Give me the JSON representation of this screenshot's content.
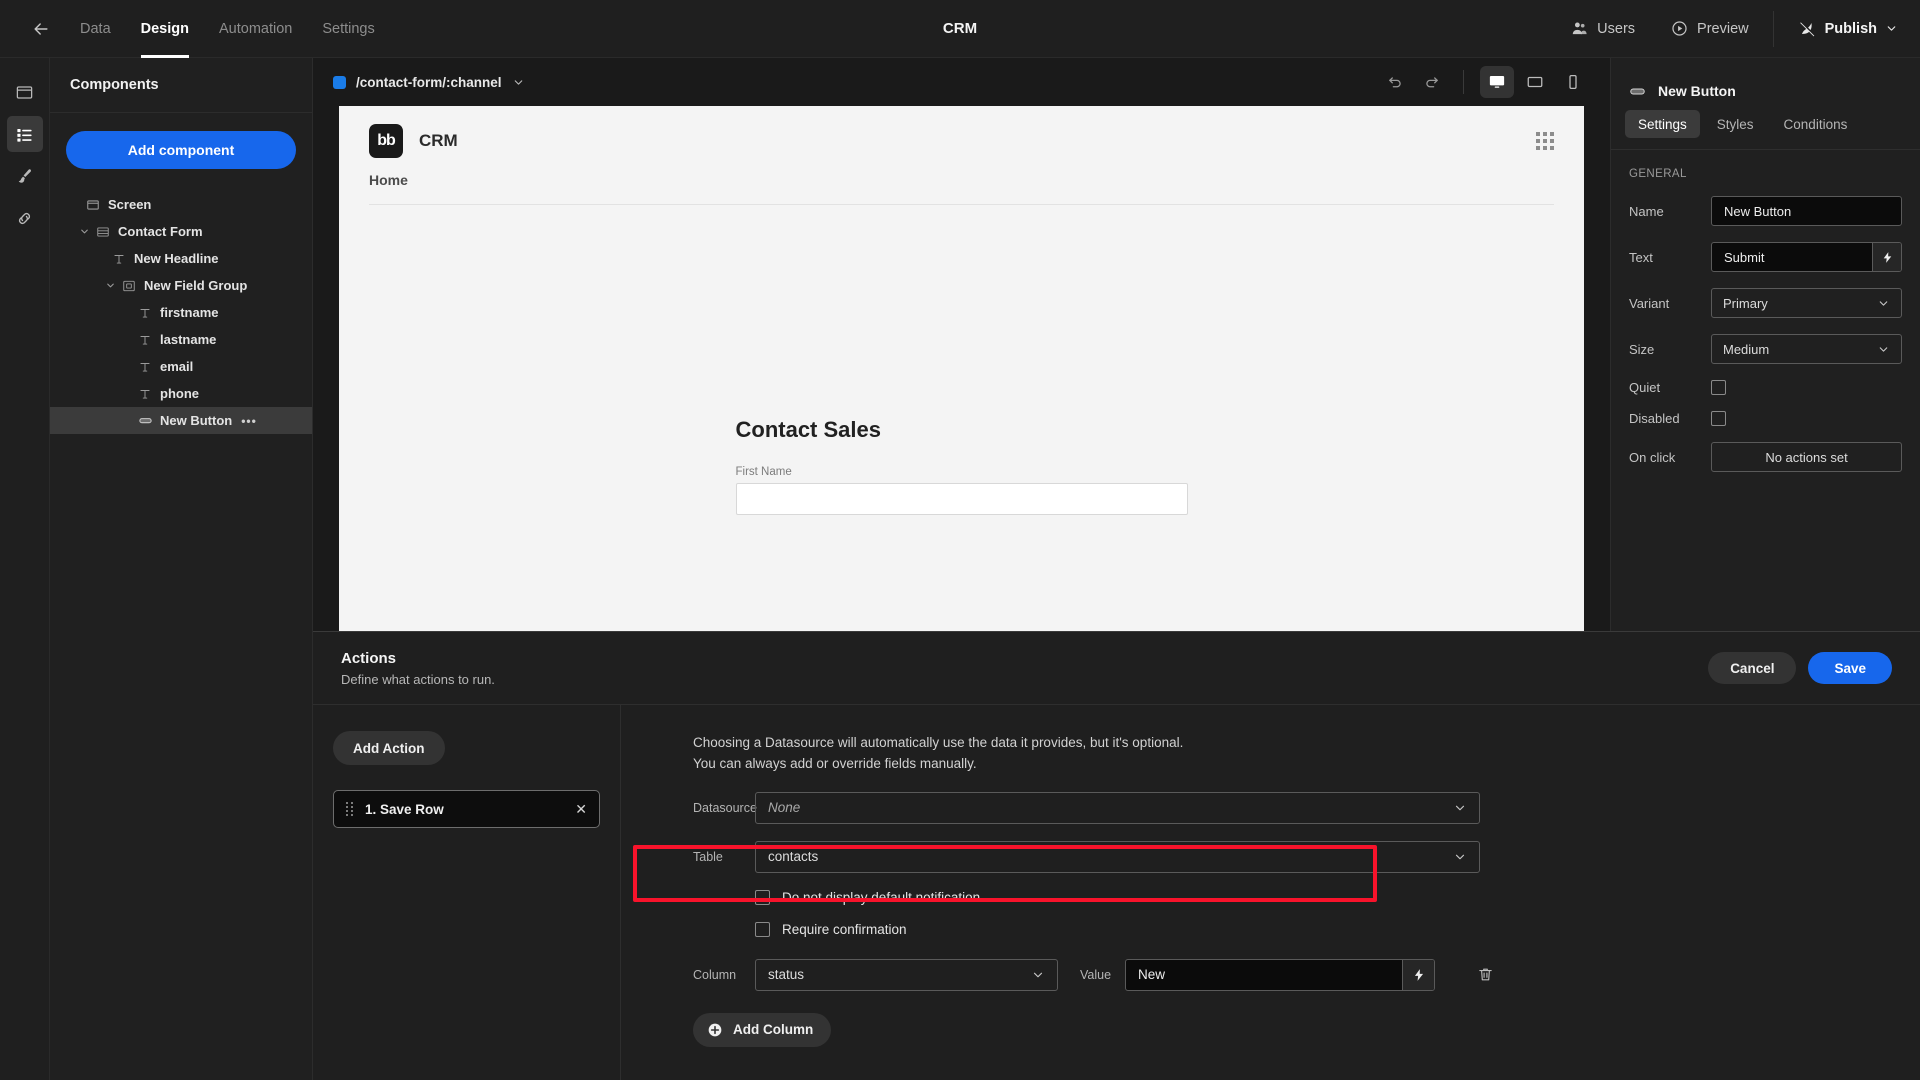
{
  "topbar": {
    "back_icon": "arrow-left-icon",
    "nav": [
      {
        "label": "Data",
        "active": false
      },
      {
        "label": "Design",
        "active": true
      },
      {
        "label": "Automation",
        "active": false
      },
      {
        "label": "Settings",
        "active": false
      }
    ],
    "app_title": "CRM",
    "users_label": "Users",
    "preview_label": "Preview",
    "publish_label": "Publish"
  },
  "rail": {
    "items": [
      {
        "name": "screen-icon",
        "active": false
      },
      {
        "name": "components-list-icon",
        "active": true
      },
      {
        "name": "theme-brush-icon",
        "active": false
      },
      {
        "name": "links-icon",
        "active": false
      }
    ]
  },
  "components": {
    "header": "Components",
    "add_button": "Add component",
    "tree": [
      {
        "label": "Screen",
        "depth": 0,
        "icon": "screen-icon",
        "caret": "",
        "selected": false
      },
      {
        "label": "Contact Form",
        "depth": 0,
        "icon": "form-icon",
        "caret": "down",
        "selected": false
      },
      {
        "label": "New Headline",
        "depth": 1,
        "icon": "text-icon",
        "caret": "",
        "selected": false
      },
      {
        "label": "New Field Group",
        "depth": 1,
        "icon": "fieldgroup-icon",
        "caret": "down",
        "selected": false
      },
      {
        "label": "firstname",
        "depth": 2,
        "icon": "text-icon",
        "caret": "",
        "selected": false
      },
      {
        "label": "lastname",
        "depth": 2,
        "icon": "text-icon",
        "caret": "",
        "selected": false
      },
      {
        "label": "email",
        "depth": 2,
        "icon": "text-icon",
        "caret": "",
        "selected": false
      },
      {
        "label": "phone",
        "depth": 2,
        "icon": "text-icon",
        "caret": "",
        "selected": false
      },
      {
        "label": "New Button",
        "depth": 2,
        "icon": "button-icon",
        "caret": "",
        "selected": true,
        "more": "•••"
      }
    ]
  },
  "canvas": {
    "screen_route": "/contact-form/:channel",
    "undo_icon": "undo-icon",
    "redo_icon": "redo-icon",
    "devices": [
      {
        "name": "desktop-icon",
        "active": true
      },
      {
        "name": "tablet-icon",
        "active": false
      },
      {
        "name": "mobile-icon",
        "active": false
      }
    ]
  },
  "preview": {
    "logo_text": "bb",
    "app_name": "CRM",
    "nav_link": "Home",
    "form_heading": "Contact Sales",
    "first_name_label": "First Name"
  },
  "drawer": {
    "title": "Actions",
    "subtitle": "Define what actions to run.",
    "cancel_label": "Cancel",
    "save_label": "Save",
    "add_action_label": "Add Action",
    "action_items": [
      {
        "label": "1. Save Row",
        "close": "✕"
      }
    ],
    "hint_line1": "Choosing a Datasource will automatically use the data it provides, but it's optional.",
    "hint_line2": "You can always add or override fields manually.",
    "datasource_label": "Datasource",
    "datasource_value": "None",
    "table_label": "Table",
    "table_value": "contacts",
    "checkbox_1": "Do not display default notification",
    "checkbox_2": "Require confirmation",
    "column_label": "Column",
    "column_value": "status",
    "value_label": "Value",
    "value_value": "New",
    "add_column_label": "Add Column",
    "highlight_color": "#f8132b"
  },
  "right_panel": {
    "component_name": "New Button",
    "tabs": [
      {
        "label": "Settings",
        "active": true
      },
      {
        "label": "Styles",
        "active": false
      },
      {
        "label": "Conditions",
        "active": false
      }
    ],
    "section_title": "GENERAL",
    "fields": {
      "name_label": "Name",
      "name_value": "New Button",
      "text_label": "Text",
      "text_value": "Submit",
      "variant_label": "Variant",
      "variant_value": "Primary",
      "size_label": "Size",
      "size_value": "Medium",
      "quiet_label": "Quiet",
      "disabled_label": "Disabled",
      "onclick_label": "On click",
      "onclick_value": "No actions set"
    }
  },
  "colors": {
    "accent": "#1767ec",
    "highlight": "#f8132b",
    "panel_bg": "#202020",
    "canvas_bg": "#1a1a1a"
  }
}
